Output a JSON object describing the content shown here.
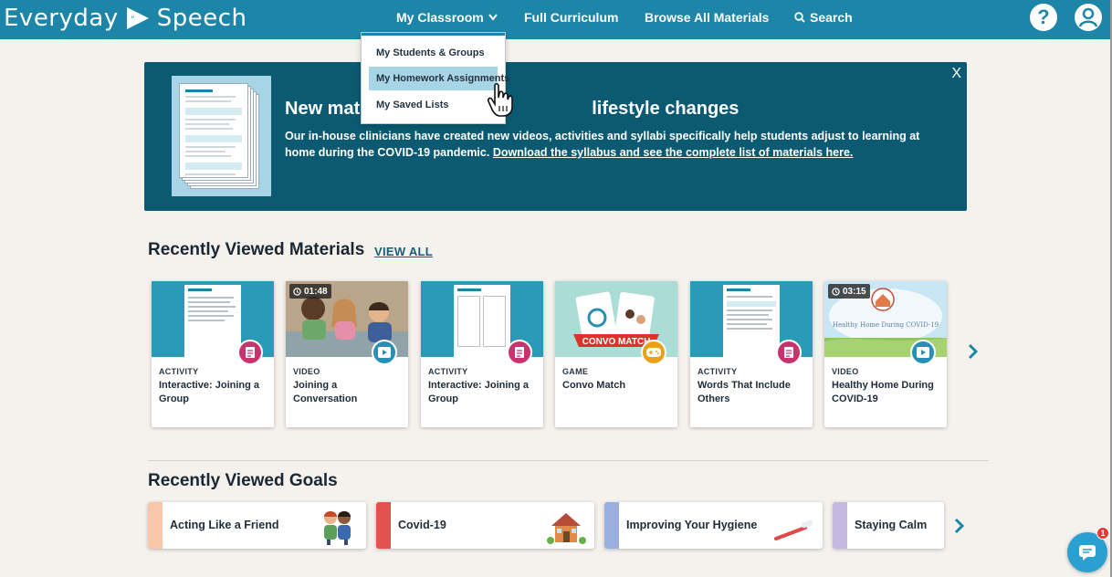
{
  "header": {
    "logo_left": "Everyday",
    "logo_right": "Speech",
    "nav": {
      "my_classroom": "My Classroom",
      "full_curriculum": "Full Curriculum",
      "browse_all": "Browse All Materials",
      "search": "Search"
    },
    "help_glyph": "?"
  },
  "dropdown": {
    "items": [
      {
        "label": "My Students & Groups"
      },
      {
        "label": "My Homework Assignments"
      },
      {
        "label": "My Saved Lists"
      }
    ]
  },
  "banner": {
    "close": "X",
    "title_start": "New mat",
    "title_end": "lifestyle changes",
    "text": "Our in-house clinicians have created new videos, activities and syllabi specifically help students adjust to learning at home during the COVID-19 pandemic. ",
    "link": "Download the syllabus and see the complete list of materials here."
  },
  "recent_materials": {
    "title": "Recently Viewed Materials",
    "view_all": "VIEW ALL",
    "cards": [
      {
        "type": "ACTIVITY",
        "title": "Interactive: Joining a Group",
        "badge": "document-icon"
      },
      {
        "type": "VIDEO",
        "title": "Joining a Conversation",
        "duration": "01:48",
        "badge": "play-icon"
      },
      {
        "type": "ACTIVITY",
        "title": "Interactive: Joining a Group",
        "badge": "document-icon"
      },
      {
        "type": "GAME",
        "title": "Convo Match",
        "badge": "gamepad-icon",
        "art_text": "CONVO MATCH"
      },
      {
        "type": "ACTIVITY",
        "title": "Words That Include Others",
        "badge": "document-icon"
      },
      {
        "type": "VIDEO",
        "title": "Healthy Home During COVID-19",
        "duration": "03:15",
        "badge": "play-icon",
        "art_text": "Healthy Home During COVID-19"
      }
    ]
  },
  "recent_goals": {
    "title": "Recently Viewed Goals",
    "goals": [
      {
        "label": "Acting Like a Friend",
        "accent": "#f8c6a8"
      },
      {
        "label": "Covid-19",
        "accent": "#e2534f"
      },
      {
        "label": "Improving Your Hygiene",
        "accent": "#9aaee0"
      },
      {
        "label": "Staying Calm",
        "accent": "#c6b7e0"
      }
    ]
  },
  "chat": {
    "count": "1"
  },
  "colors": {
    "brand": "#1d86a8",
    "banner": "#0b5a72"
  }
}
